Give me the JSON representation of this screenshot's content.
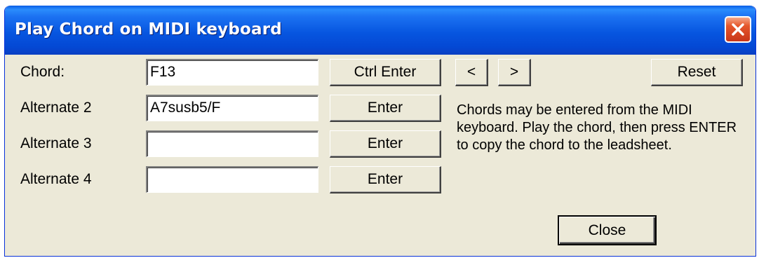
{
  "window": {
    "title": "Play Chord on MIDI keyboard"
  },
  "rows": [
    {
      "label": "Chord:",
      "value": "F13",
      "button": "Ctrl Enter"
    },
    {
      "label": "Alternate 2",
      "value": "A7susb5/F",
      "button": "Enter"
    },
    {
      "label": "Alternate 3",
      "value": "",
      "button": "Enter"
    },
    {
      "label": "Alternate 4",
      "value": "",
      "button": "Enter"
    }
  ],
  "nav": {
    "prev_label": "<",
    "next_label": ">",
    "reset_label": "Reset"
  },
  "info_text": "Chords may be entered from the MIDI keyboard. Play the chord, then press ENTER to copy the chord to the leadsheet.",
  "close_label": "Close",
  "icons": {
    "close": "close-x-icon"
  },
  "colors": {
    "titlebar": "#0756e0",
    "close_button": "#e5562b",
    "dialog_background": "#ece9d8"
  }
}
